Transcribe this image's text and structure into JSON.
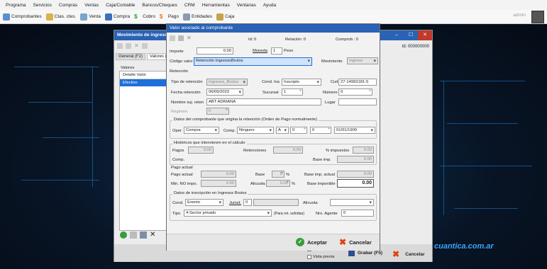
{
  "menu": [
    "Programa",
    "Servicios",
    "Compras",
    "Ventas",
    "Caja/Contable",
    "Bancos/Cheques",
    "CRM",
    "Herramientas",
    "Ventanas",
    "Ayuda"
  ],
  "toolbar": [
    "Comprobantes",
    "Ctas. ctes.",
    "Venta",
    "Compra",
    "Cobro",
    "Pago",
    "Entidades",
    "Caja"
  ],
  "user": "admin",
  "watermark": "cuantica.com.ar",
  "back": {
    "title": "Movimiento de ingreso",
    "id_label": "Id: 000000000",
    "tabs": [
      "General (F2)",
      "Valores (F3"
    ],
    "valores_label": "Valores",
    "list_header": "Detalle Valor",
    "list_item": "Efectivo",
    "imprimir": "Imprimir",
    "vista_previa": "Vista previa",
    "grabar": "Grabar (F5)",
    "cancelar": "Cancelar"
  },
  "dlg": {
    "title": "Valor asociado al comprobante",
    "id": "Id: 0",
    "relacion": "Relación: 0",
    "comprob": "Comprob.: 0",
    "importe_lbl": "Importe",
    "importe": "0.00",
    "moneda_lbl": "Moneda",
    "moneda": "1",
    "moneda_name": "Peso",
    "codigo_lbl": "Código valor",
    "codigo": "Retención IngresosBrutos",
    "movimiento_lbl": "Movimiento",
    "movimiento": "Ingreso",
    "retencion_group": "Retención",
    "tipo_ret_lbl": "Tipo de retención",
    "tipo_ret": "Ingresos_Brutos",
    "cond_iva_lbl": "Cond. Iva",
    "cond_iva": "Inscripto",
    "cuit_lbl": "Cuit",
    "cuit": "27-14993181-5",
    "fecha_ret_lbl": "Fecha retención",
    "fecha_ret": "06/09/2023",
    "sucursal_lbl": "Sucursal",
    "sucursal": "1",
    "numero_lbl": "Número",
    "numero": "0",
    "nombre_lbl": "Nombre suj. reten",
    "nombre": "ABT ADRIANA",
    "lugar_lbl": "Lugar",
    "regimen_lbl": "Régimen",
    "regimen": "0",
    "orig_title": "Datos del comprobante que origina la retención (Orden de Pago normalmente)",
    "oper_lbl": "Oper",
    "oper": "Compra",
    "comp_lbl": "Comp.",
    "comp": "Ninguno",
    "letra": "A",
    "suc2": "0",
    "num2": "0",
    "fecha2": "01/01/1900",
    "hist_title": "Históricos que intervienen en el cálculo",
    "pagos_lbl": "Pagos",
    "pagos": "0.00",
    "retenciones_lbl": "Retenciones",
    "retenciones": "0.00",
    "pct_imp_lbl": "% impuestos",
    "pct_imp": "0.00",
    "comp2_lbl": "Comp.",
    "base_imp_lbl": "Base imp.",
    "base_imp": "0.00",
    "pago_actual_title": "Pago actual",
    "pago_actual_lbl": "Pago actual",
    "pago_actual": "0.00",
    "base_lbl": "Base",
    "base": "0",
    "base_imp_actual_lbl": "Base imp. actual",
    "base_imp_actual": "0.00",
    "min_no_imp_lbl": "Min. NO impo.",
    "min_no_imp": "0.00",
    "alicuota_lbl": "Alicuota",
    "alicuota": "0.00",
    "base_imponible_lbl": "Base imponible",
    "base_imponible": "0.00",
    "insc_title": "Datos de inscripción en Ingresos Brutos",
    "cond_lbl": "Cond.",
    "cond": "Exento",
    "jurisd_lbl": "Jurisd.",
    "jurisd": "0",
    "alicuota2_lbl": "Alicuota",
    "tipo_lbl": "Tipo",
    "tipo": "4-Sector privado",
    "para_ret": "(Para ret. sufridas)",
    "nro_agente_lbl": "Nro. Agente",
    "nro_agente": "0",
    "aceptar": "Aceptar",
    "cancelar": "Cancelar"
  },
  "colors": {
    "titlebar": "#2a62b5",
    "selected": "#1e6fd9",
    "accent_trace": "#1f7fd6"
  }
}
